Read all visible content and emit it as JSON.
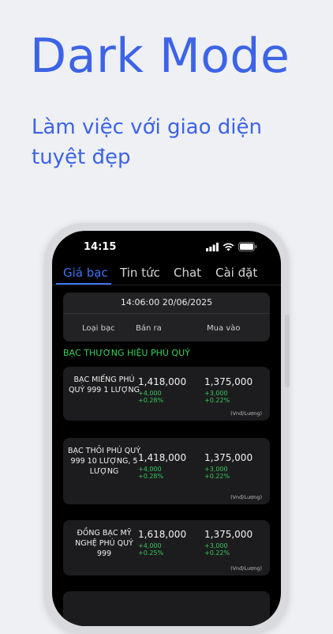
{
  "hero": {
    "title": "Dark Mode",
    "subtitle": "Làm việc với giao diện tuyệt đẹp"
  },
  "status_bar": {
    "time": "14:15",
    "icons": [
      "cellular-icon",
      "wifi-icon",
      "battery-icon"
    ]
  },
  "tabs": [
    {
      "label": "Giá bạc",
      "active": true
    },
    {
      "label": "Tin tức",
      "active": false
    },
    {
      "label": "Chat",
      "active": false
    },
    {
      "label": "Cài đặt",
      "active": false
    }
  ],
  "table_header": {
    "datetime": "14:06:00 20/06/2025",
    "col_type": "Loại bạc",
    "col_sell": "Bán ra",
    "col_buy": "Mua vào"
  },
  "section": {
    "title": "BẠC THƯƠNG HIỆU PHÚ QUÝ"
  },
  "rows": [
    {
      "name": "BẠC MIẾNG PHÚ QUÝ 999 1 LƯỢNG",
      "sell": "1,418,000",
      "sell_change": "+4,000",
      "sell_pct": "+0.28%",
      "buy": "1,375,000",
      "buy_change": "+3,000",
      "buy_pct": "+0.22%",
      "unit": "(Vnđ/Lượng)"
    },
    {
      "name": "BẠC THỎI PHÚ QUÝ 999 10 LƯỢNG, 5 LƯỢNG",
      "sell": "1,418,000",
      "sell_change": "+4,000",
      "sell_pct": "+0.28%",
      "buy": "1,375,000",
      "buy_change": "+3,000",
      "buy_pct": "+0.22%",
      "unit": "(Vnđ/Lượng)"
    },
    {
      "name": "ĐỒNG BẠC MỸ NGHỆ PHÚ QUÝ 999",
      "sell": "1,618,000",
      "sell_change": "+4,000",
      "sell_pct": "+0.25%",
      "buy": "1,375,000",
      "buy_change": "+3,000",
      "buy_pct": "+0.22%",
      "unit": "(Vnđ/Lượng)"
    }
  ],
  "colors": {
    "accent": "#3d63e6",
    "tab_active": "#3d74f0",
    "positive": "#39c75a",
    "section": "#3bd15a"
  }
}
